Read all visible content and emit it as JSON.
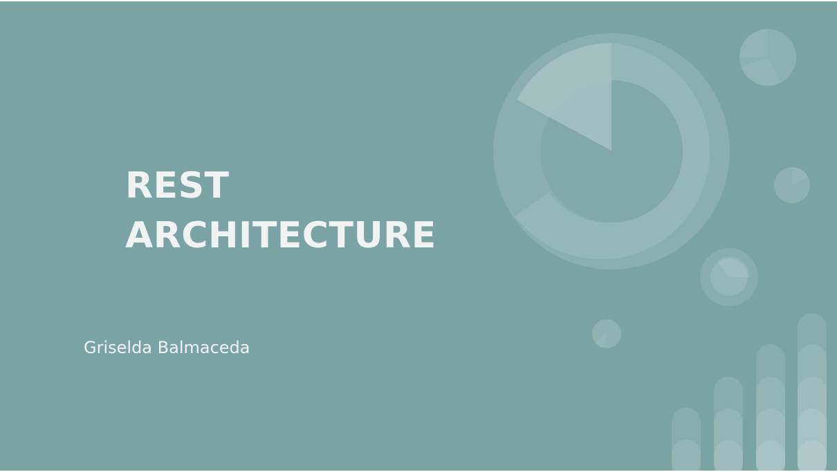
{
  "slide": {
    "title_lines": [
      "REST",
      "ARCHITECTURE"
    ],
    "subtitle": "Griselda Balmaceda"
  },
  "colors": {
    "background": "#7aa4a3",
    "text": "#f1f3f3",
    "frame": "#ffffff"
  },
  "decorations": {
    "donut_chart_icon": "large-donut",
    "pie_icons": [
      "pie-top-right",
      "pie-right-small",
      "ring-pie-middle",
      "pie-tiny"
    ],
    "bar_graphic": "rounded-bars"
  }
}
